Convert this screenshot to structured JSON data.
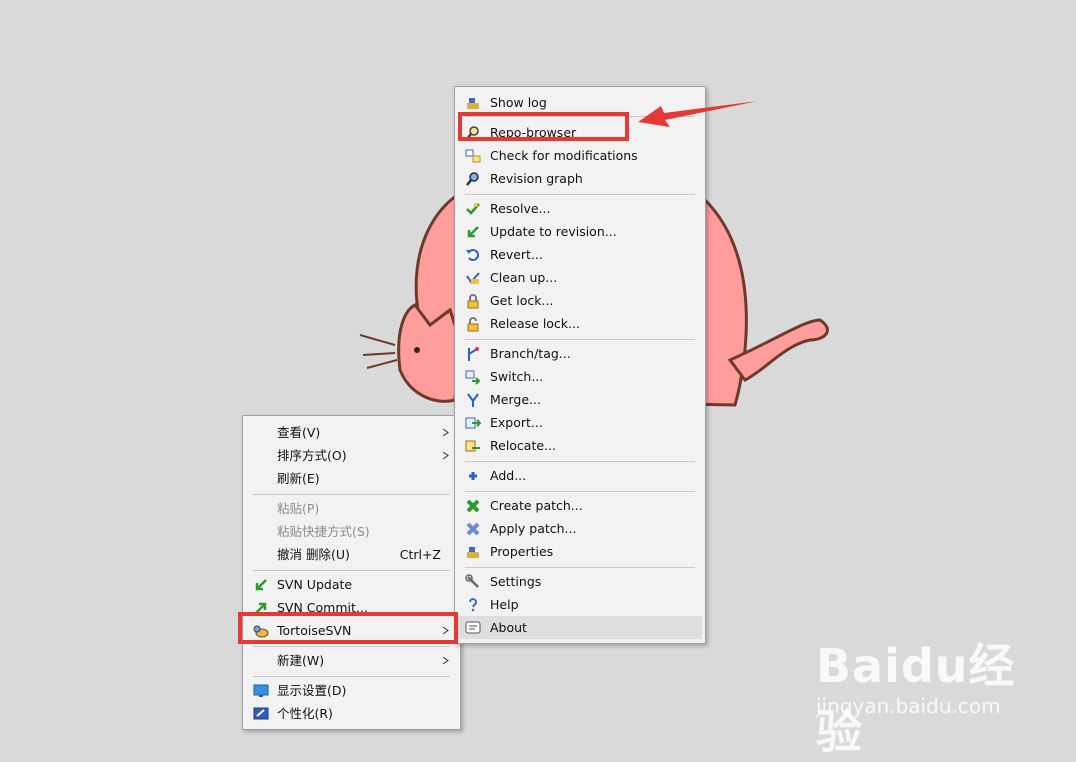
{
  "context_menu": {
    "items": [
      {
        "label": "查看(V)",
        "submenu": true
      },
      {
        "label": "排序方式(O)",
        "submenu": true
      },
      {
        "label": "刷新(E)"
      },
      {
        "label": "粘贴(P)",
        "disabled": true
      },
      {
        "label": "粘贴快捷方式(S)",
        "disabled": true
      },
      {
        "label": "撤消 删除(U)",
        "accel": "Ctrl+Z"
      },
      {
        "label": "SVN Update",
        "icon": "svn-update-icon"
      },
      {
        "label": "SVN Commit...",
        "icon": "svn-commit-icon"
      },
      {
        "label": "TortoiseSVN",
        "icon": "tortoisesvn-icon",
        "submenu": true
      },
      {
        "label": "新建(W)",
        "submenu": true
      },
      {
        "label": "显示设置(D)",
        "icon": "display-settings-icon"
      },
      {
        "label": "个性化(R)",
        "icon": "personalize-icon"
      }
    ]
  },
  "tortoise_menu": {
    "items": [
      {
        "label": "Show log",
        "icon": "show-log-icon"
      },
      {
        "label": "Repo-browser",
        "icon": "repo-browser-icon"
      },
      {
        "label": "Check for modifications",
        "icon": "check-modifications-icon"
      },
      {
        "label": "Revision graph",
        "icon": "revision-graph-icon"
      },
      {
        "label": "Resolve...",
        "icon": "resolve-icon"
      },
      {
        "label": "Update to revision...",
        "icon": "update-revision-icon"
      },
      {
        "label": "Revert...",
        "icon": "revert-icon"
      },
      {
        "label": "Clean up...",
        "icon": "cleanup-icon"
      },
      {
        "label": "Get lock...",
        "icon": "get-lock-icon"
      },
      {
        "label": "Release lock...",
        "icon": "release-lock-icon"
      },
      {
        "label": "Branch/tag...",
        "icon": "branch-tag-icon"
      },
      {
        "label": "Switch...",
        "icon": "switch-icon"
      },
      {
        "label": "Merge...",
        "icon": "merge-icon"
      },
      {
        "label": "Export...",
        "icon": "export-icon"
      },
      {
        "label": "Relocate...",
        "icon": "relocate-icon"
      },
      {
        "label": "Add...",
        "icon": "add-icon"
      },
      {
        "label": "Create patch...",
        "icon": "create-patch-icon"
      },
      {
        "label": "Apply patch...",
        "icon": "apply-patch-icon"
      },
      {
        "label": "Properties",
        "icon": "properties-icon"
      },
      {
        "label": "Settings",
        "icon": "settings-icon"
      },
      {
        "label": "Help",
        "icon": "help-icon"
      },
      {
        "label": "About",
        "icon": "about-icon"
      }
    ]
  },
  "watermark": {
    "brand": "Baidu经验",
    "url": "jingyan.baidu.com"
  },
  "colors": {
    "highlight": "#e53935",
    "menu_bg": "#f2f2f2",
    "desktop": "#d9d9d9"
  }
}
